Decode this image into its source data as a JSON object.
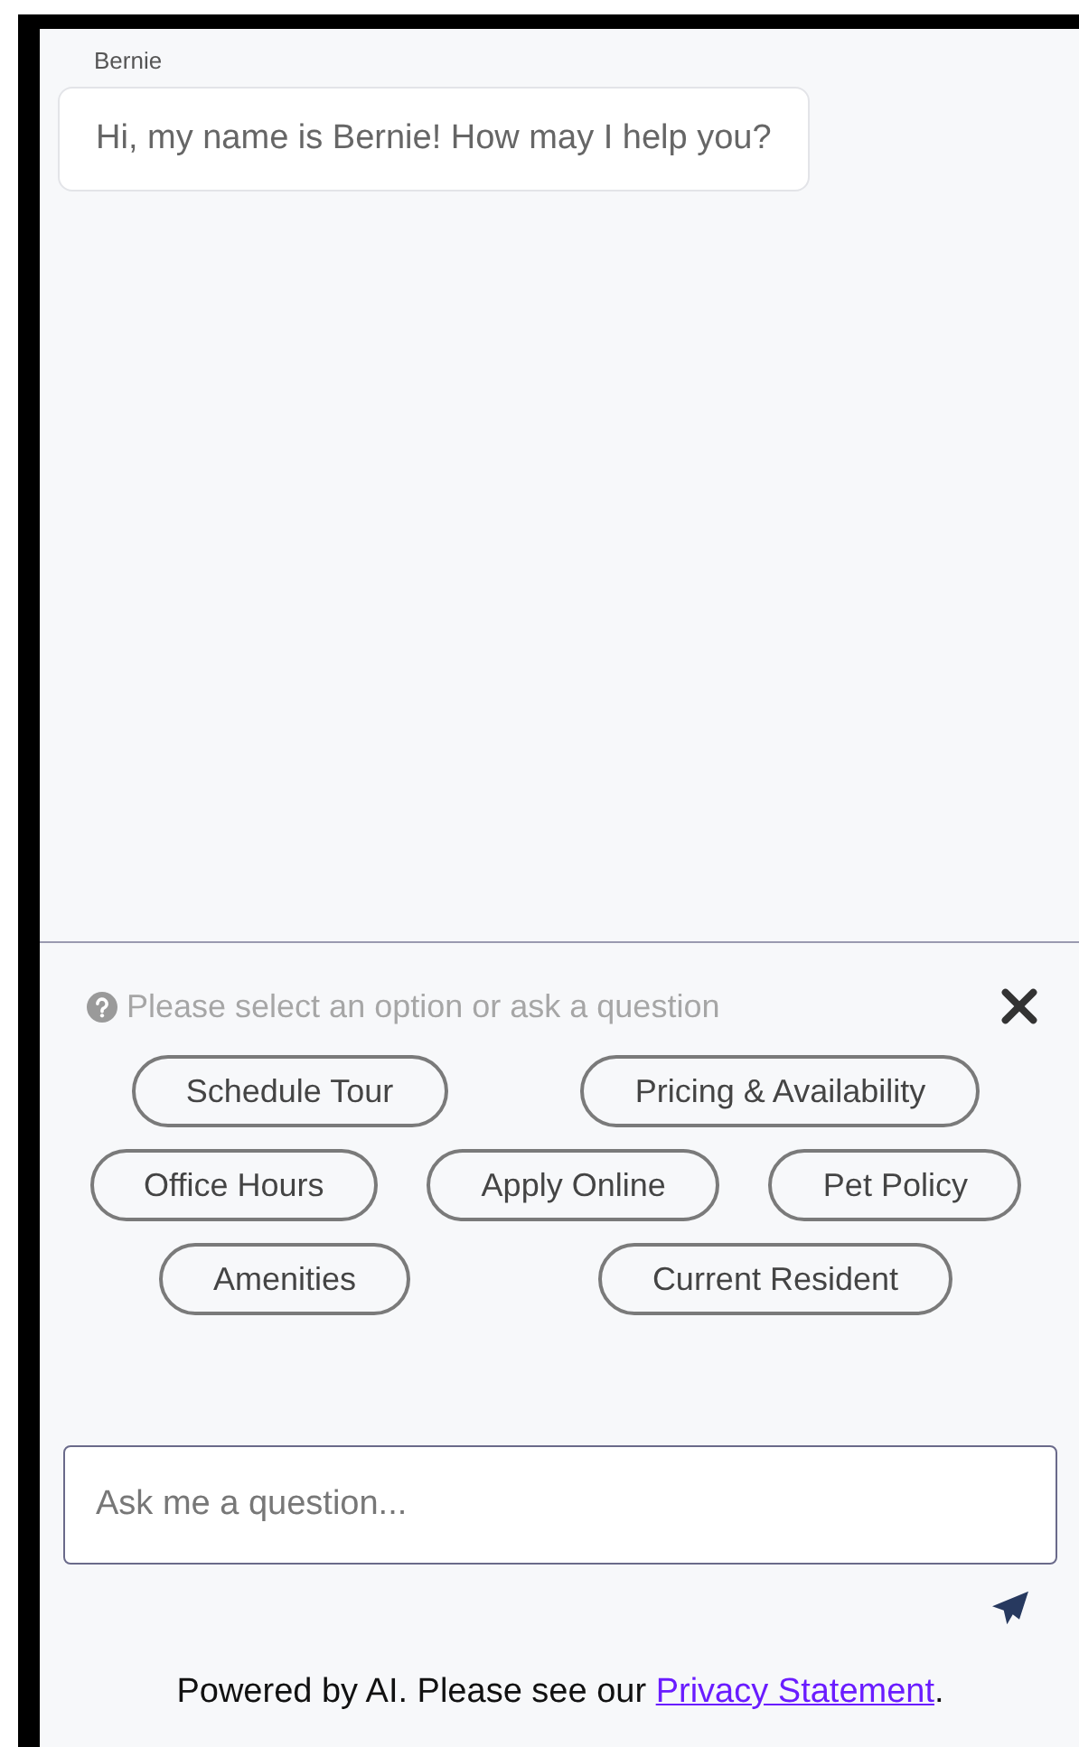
{
  "chat": {
    "messages": [
      {
        "sender": "Bernie",
        "text": "Hi, my name is Bernie! How may I help you?"
      }
    ]
  },
  "options": {
    "prompt": "Please select an option or ask a question",
    "rows": [
      [
        "Schedule Tour",
        "Pricing & Availability"
      ],
      [
        "Office Hours",
        "Apply Online",
        "Pet Policy"
      ],
      [
        "Amenities",
        "Current Resident"
      ]
    ]
  },
  "input": {
    "placeholder": "Ask me a question..."
  },
  "footer": {
    "text": "Powered by AI. Please see our ",
    "link": "Privacy Statement",
    "end": "."
  }
}
